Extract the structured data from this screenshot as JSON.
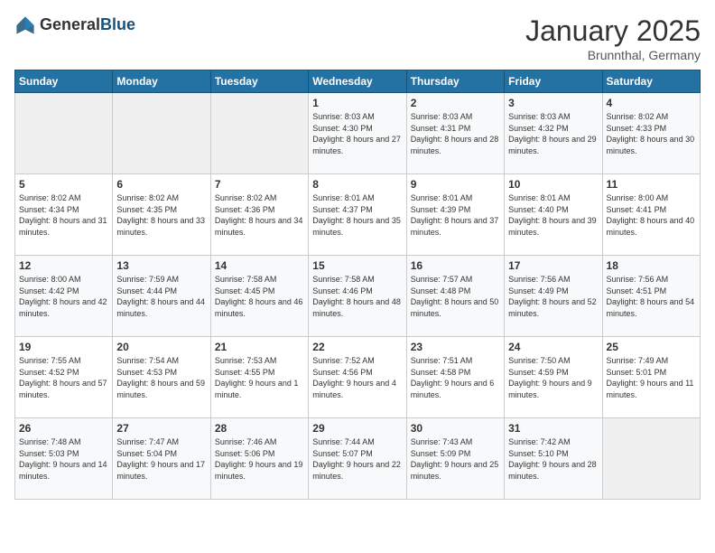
{
  "header": {
    "logo_general": "General",
    "logo_blue": "Blue",
    "month": "January 2025",
    "location": "Brunnthal, Germany"
  },
  "days_of_week": [
    "Sunday",
    "Monday",
    "Tuesday",
    "Wednesday",
    "Thursday",
    "Friday",
    "Saturday"
  ],
  "weeks": [
    [
      {
        "day": "",
        "info": ""
      },
      {
        "day": "",
        "info": ""
      },
      {
        "day": "",
        "info": ""
      },
      {
        "day": "1",
        "info": "Sunrise: 8:03 AM\nSunset: 4:30 PM\nDaylight: 8 hours and 27 minutes."
      },
      {
        "day": "2",
        "info": "Sunrise: 8:03 AM\nSunset: 4:31 PM\nDaylight: 8 hours and 28 minutes."
      },
      {
        "day": "3",
        "info": "Sunrise: 8:03 AM\nSunset: 4:32 PM\nDaylight: 8 hours and 29 minutes."
      },
      {
        "day": "4",
        "info": "Sunrise: 8:02 AM\nSunset: 4:33 PM\nDaylight: 8 hours and 30 minutes."
      }
    ],
    [
      {
        "day": "5",
        "info": "Sunrise: 8:02 AM\nSunset: 4:34 PM\nDaylight: 8 hours and 31 minutes."
      },
      {
        "day": "6",
        "info": "Sunrise: 8:02 AM\nSunset: 4:35 PM\nDaylight: 8 hours and 33 minutes."
      },
      {
        "day": "7",
        "info": "Sunrise: 8:02 AM\nSunset: 4:36 PM\nDaylight: 8 hours and 34 minutes."
      },
      {
        "day": "8",
        "info": "Sunrise: 8:01 AM\nSunset: 4:37 PM\nDaylight: 8 hours and 35 minutes."
      },
      {
        "day": "9",
        "info": "Sunrise: 8:01 AM\nSunset: 4:39 PM\nDaylight: 8 hours and 37 minutes."
      },
      {
        "day": "10",
        "info": "Sunrise: 8:01 AM\nSunset: 4:40 PM\nDaylight: 8 hours and 39 minutes."
      },
      {
        "day": "11",
        "info": "Sunrise: 8:00 AM\nSunset: 4:41 PM\nDaylight: 8 hours and 40 minutes."
      }
    ],
    [
      {
        "day": "12",
        "info": "Sunrise: 8:00 AM\nSunset: 4:42 PM\nDaylight: 8 hours and 42 minutes."
      },
      {
        "day": "13",
        "info": "Sunrise: 7:59 AM\nSunset: 4:44 PM\nDaylight: 8 hours and 44 minutes."
      },
      {
        "day": "14",
        "info": "Sunrise: 7:58 AM\nSunset: 4:45 PM\nDaylight: 8 hours and 46 minutes."
      },
      {
        "day": "15",
        "info": "Sunrise: 7:58 AM\nSunset: 4:46 PM\nDaylight: 8 hours and 48 minutes."
      },
      {
        "day": "16",
        "info": "Sunrise: 7:57 AM\nSunset: 4:48 PM\nDaylight: 8 hours and 50 minutes."
      },
      {
        "day": "17",
        "info": "Sunrise: 7:56 AM\nSunset: 4:49 PM\nDaylight: 8 hours and 52 minutes."
      },
      {
        "day": "18",
        "info": "Sunrise: 7:56 AM\nSunset: 4:51 PM\nDaylight: 8 hours and 54 minutes."
      }
    ],
    [
      {
        "day": "19",
        "info": "Sunrise: 7:55 AM\nSunset: 4:52 PM\nDaylight: 8 hours and 57 minutes."
      },
      {
        "day": "20",
        "info": "Sunrise: 7:54 AM\nSunset: 4:53 PM\nDaylight: 8 hours and 59 minutes."
      },
      {
        "day": "21",
        "info": "Sunrise: 7:53 AM\nSunset: 4:55 PM\nDaylight: 9 hours and 1 minute."
      },
      {
        "day": "22",
        "info": "Sunrise: 7:52 AM\nSunset: 4:56 PM\nDaylight: 9 hours and 4 minutes."
      },
      {
        "day": "23",
        "info": "Sunrise: 7:51 AM\nSunset: 4:58 PM\nDaylight: 9 hours and 6 minutes."
      },
      {
        "day": "24",
        "info": "Sunrise: 7:50 AM\nSunset: 4:59 PM\nDaylight: 9 hours and 9 minutes."
      },
      {
        "day": "25",
        "info": "Sunrise: 7:49 AM\nSunset: 5:01 PM\nDaylight: 9 hours and 11 minutes."
      }
    ],
    [
      {
        "day": "26",
        "info": "Sunrise: 7:48 AM\nSunset: 5:03 PM\nDaylight: 9 hours and 14 minutes."
      },
      {
        "day": "27",
        "info": "Sunrise: 7:47 AM\nSunset: 5:04 PM\nDaylight: 9 hours and 17 minutes."
      },
      {
        "day": "28",
        "info": "Sunrise: 7:46 AM\nSunset: 5:06 PM\nDaylight: 9 hours and 19 minutes."
      },
      {
        "day": "29",
        "info": "Sunrise: 7:44 AM\nSunset: 5:07 PM\nDaylight: 9 hours and 22 minutes."
      },
      {
        "day": "30",
        "info": "Sunrise: 7:43 AM\nSunset: 5:09 PM\nDaylight: 9 hours and 25 minutes."
      },
      {
        "day": "31",
        "info": "Sunrise: 7:42 AM\nSunset: 5:10 PM\nDaylight: 9 hours and 28 minutes."
      },
      {
        "day": "",
        "info": ""
      }
    ]
  ]
}
